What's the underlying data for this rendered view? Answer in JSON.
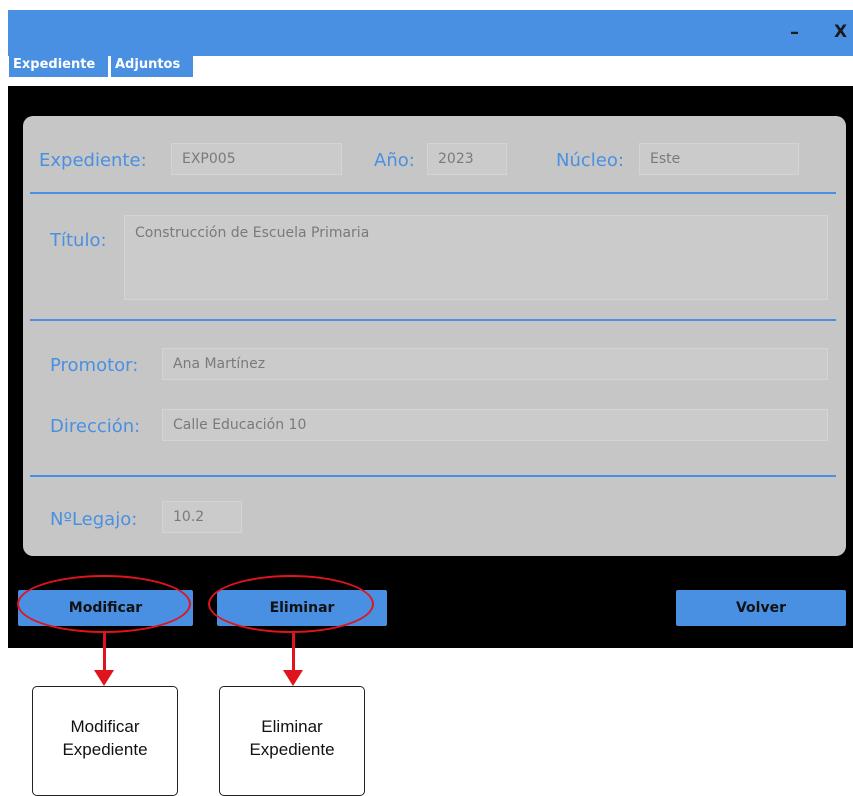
{
  "window": {
    "minimize_label": "–",
    "close_label": "X"
  },
  "tabs": [
    "Expediente",
    "Adjuntos"
  ],
  "form": {
    "expediente": {
      "label": "Expediente:",
      "value": "EXP005"
    },
    "anio": {
      "label": "Año:",
      "value": "2023"
    },
    "nucleo": {
      "label": "Núcleo:",
      "value": "Este"
    },
    "titulo": {
      "label": "Título:",
      "value": "Construcción de Escuela Primaria"
    },
    "promotor": {
      "label": "Promotor:",
      "value": "Ana Martínez"
    },
    "direccion": {
      "label": "Dirección:",
      "value": "Calle Educación 10"
    },
    "legajo": {
      "label": "NºLegajo:",
      "value": "10.2"
    }
  },
  "buttons": {
    "modificar": "Modificar",
    "eliminar": "Eliminar",
    "volver": "Volver"
  },
  "annotations": {
    "modificar": [
      "Modificar",
      "Expediente"
    ],
    "eliminar": [
      "Eliminar",
      "Expediente"
    ]
  },
  "colors": {
    "accent": "#4a90e2",
    "annotation": "#e0141c",
    "window_bg": "#000000",
    "panel": "#c6c6c6"
  }
}
